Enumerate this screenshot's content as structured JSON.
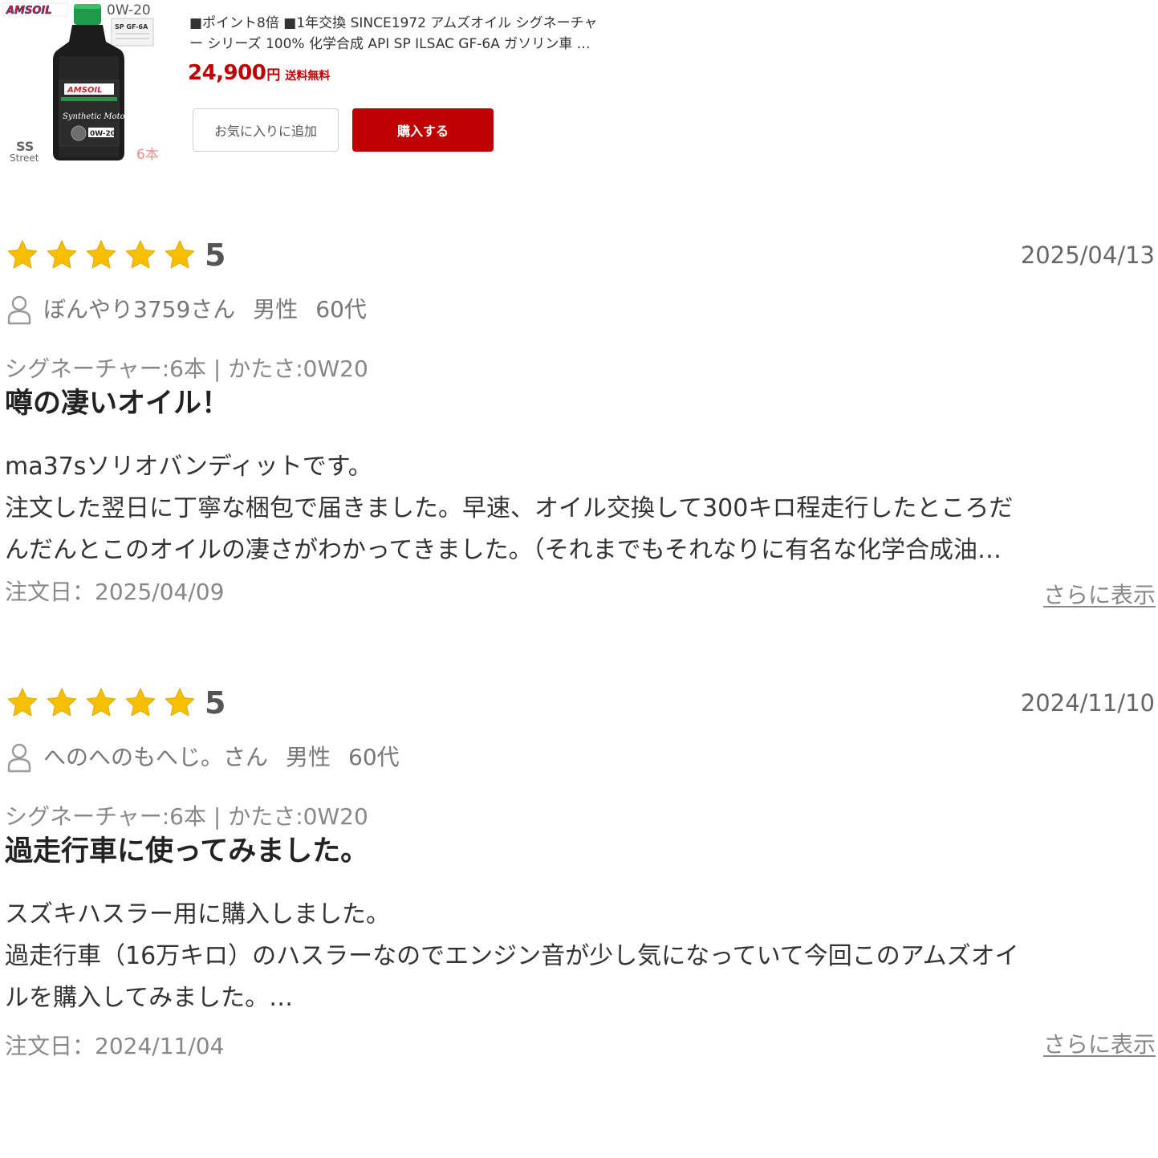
{
  "product": {
    "image": {
      "brand_logo_text": "AMSOIL",
      "viscosity_text": "0W-20",
      "spec_label_text": "SP GF-6A",
      "bottle_label_text": "Synthetic Motor Oil",
      "series_text": "SS",
      "series_sub_text": "Street",
      "quantity_text": "6本"
    },
    "title_line1": "■ポイント8倍 ■1年交換 SINCE1972 アムズオイル シグネーチャ",
    "title_line2": "ー シリーズ 100% 化学合成 API SP ILSAC GF-6A ガソリン車 …",
    "price": {
      "amount": "24,900",
      "unit": "円",
      "shipping": "送料無料"
    },
    "favorite_button_label": "お気に入りに追加",
    "buy_button_label": "購入する",
    "colors": {
      "accent_red": "#bf0000"
    }
  },
  "reviews": [
    {
      "rating": "5",
      "stars": 5,
      "date": "2025/04/13",
      "reviewer_name": "ぼんやり3759さん",
      "reviewer_gender": "男性",
      "reviewer_age": "60代",
      "variant": "シグネーチャー:6本 | かたさ:0W20",
      "title": "噂の凄いオイル！",
      "body_lines": [
        "ma37sソリオバンディットです。",
        "注文した翌日に丁寧な梱包で届きました。早速、オイル交換して300キロ程走行したところだ",
        "んだんとこのオイルの凄さがわかってきました。（それまでもそれなりに有名な化学合成油…"
      ],
      "order_date": "注文日：2025/04/09",
      "more_link": "さらに表示"
    },
    {
      "rating": "5",
      "stars": 5,
      "date": "2024/11/10",
      "reviewer_name": "へのへのもへじ。さん",
      "reviewer_gender": "男性",
      "reviewer_age": "60代",
      "variant": "シグネーチャー:6本 | かたさ:0W20",
      "title": "過走行車に使ってみました。",
      "body_lines": [
        "スズキハスラー用に購入しました。",
        "過走行車（16万キロ）のハスラーなのでエンジン音が少し気になっていて今回このアムズオイ",
        "ルを購入してみました。…"
      ],
      "order_date": "注文日：2024/11/04",
      "more_link": "さらに表示"
    }
  ]
}
